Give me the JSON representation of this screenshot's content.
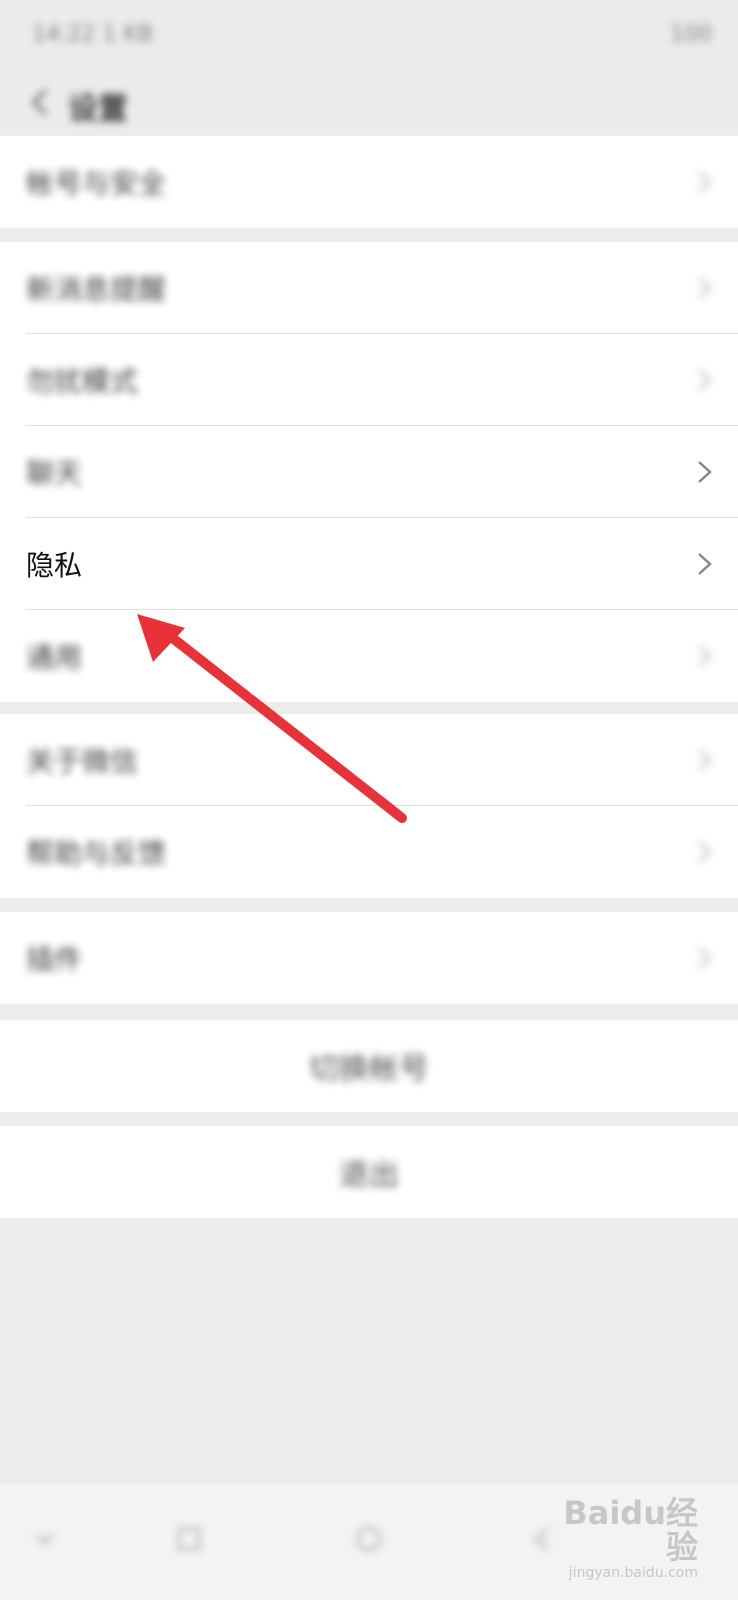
{
  "status": {
    "time": "14:22",
    "info": "1 KB",
    "battery": "100"
  },
  "header": {
    "title": "设置",
    "back_icon": "chevron-left-icon"
  },
  "groups": [
    {
      "items": [
        {
          "label": "帐号与安全"
        }
      ]
    },
    {
      "items": [
        {
          "label": "新消息提醒"
        },
        {
          "label": "勿扰模式"
        },
        {
          "label": "聊天"
        },
        {
          "label": "隐私"
        },
        {
          "label": "通用"
        }
      ]
    },
    {
      "items": [
        {
          "label": "关于微信"
        },
        {
          "label": "帮助与反馈"
        }
      ]
    },
    {
      "items": [
        {
          "label": "插件"
        }
      ]
    }
  ],
  "actions": {
    "switch_account": "切换帐号",
    "logout": "退出"
  },
  "annotation": {
    "color": "#e8323a"
  },
  "watermark": {
    "brand": "Baidu经验",
    "site": "jingyan.baidu.com"
  }
}
